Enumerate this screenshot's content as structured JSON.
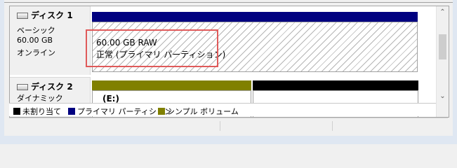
{
  "disk1": {
    "name": "ディスク 1",
    "type": "ベーシック",
    "size": "60.00 GB",
    "status": "オンライン",
    "bar_color": "#000080",
    "partition_size": "60.00 GB RAW",
    "partition_status": "正常 (プライマリ パーティション)"
  },
  "disk2": {
    "name": "ディスク 2",
    "type": "ダイナミック",
    "bar_colors": [
      "#808000",
      "#000000"
    ],
    "volume_label": "(E:)"
  },
  "legend": [
    {
      "label": "未割り当て",
      "color": "#000000"
    },
    {
      "label": "プライマリ パーティション",
      "color": "#000080"
    },
    {
      "label": "シンプル ボリューム",
      "color": "#808000"
    }
  ],
  "scrollbar": {
    "up_icon": "chevron-up-icon",
    "down_icon": "chevron-down-icon"
  }
}
